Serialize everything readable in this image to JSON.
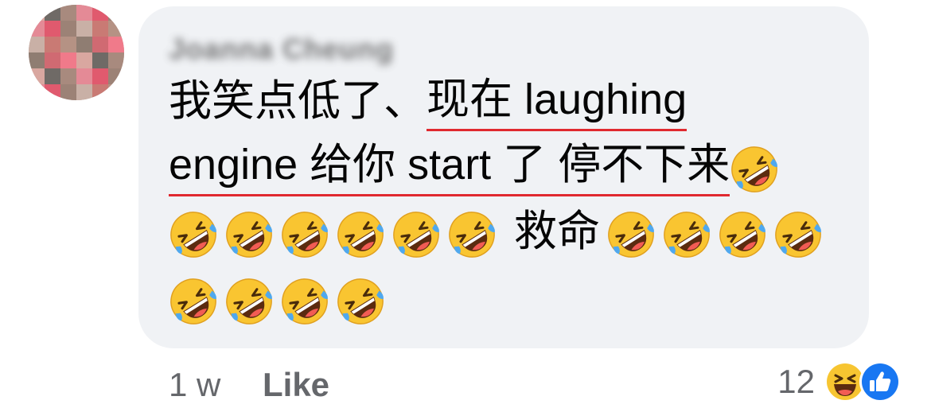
{
  "comment": {
    "author": "Joanna Cheung",
    "line1_plain": "我笑点低了、",
    "line1_underlined": "现在 laughing",
    "line2_underlined": "engine 给你 start 了 停不下来",
    "line3_text": "救命"
  },
  "emoji": {
    "name": "rolling-on-floor-laughing",
    "line2_count": 1,
    "line3_before_count": 6,
    "line3_after_count": 4,
    "line4_count": 4
  },
  "footer": {
    "time": "1 w",
    "like_label": "Like",
    "reaction_count": "12"
  },
  "colors": {
    "bubble": "#f0f2f5",
    "underline": "#e0292f",
    "meta_text": "#65676b",
    "like_blue": "#1877f2"
  }
}
